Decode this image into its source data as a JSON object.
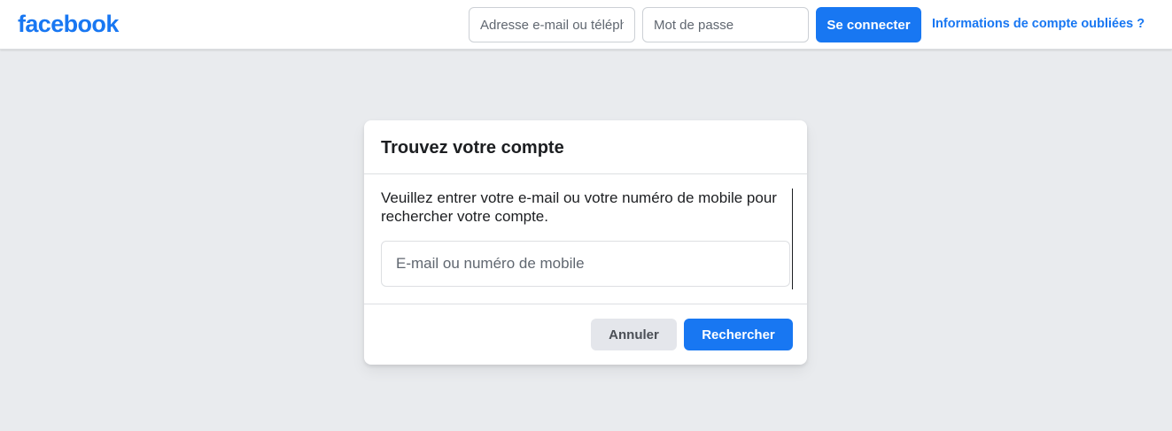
{
  "header": {
    "logo_text": "facebook",
    "email_placeholder": "Adresse e-mail ou téléphone",
    "password_placeholder": "Mot de passe",
    "login_label": "Se connecter",
    "forgot_label": "Informations de compte oubliées ?"
  },
  "dialog": {
    "title": "Trouvez votre compte",
    "description": "Veuillez entrer votre e-mail ou votre numéro de mobile pour rechercher votre compte.",
    "search_placeholder": "E-mail ou numéro de mobile",
    "cancel_label": "Annuler",
    "search_label": "Rechercher"
  },
  "colors": {
    "brand": "#1877f2",
    "page_background": "#e9ebee",
    "secondary_button": "#e4e6eb"
  }
}
